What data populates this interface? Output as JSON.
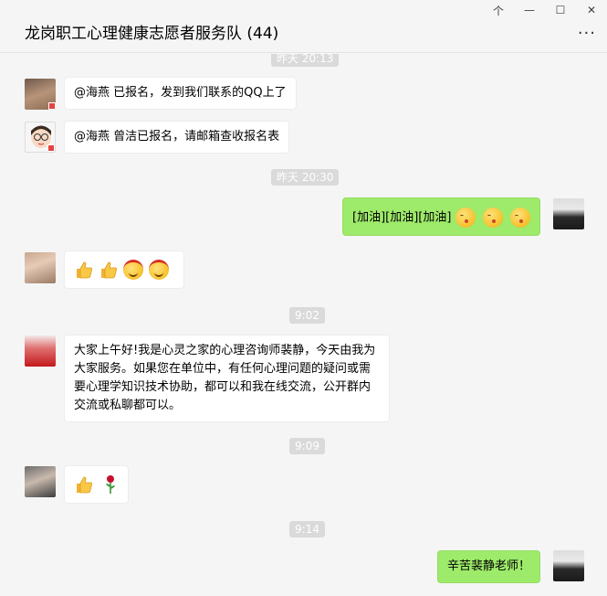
{
  "window": {
    "title": "龙岗职工心理健康志愿者服务队 (44)",
    "controls": [
      "个",
      "—",
      "☐",
      "✕"
    ],
    "more": "···"
  },
  "timestamps": [
    "昨天 20:13",
    "昨天 20:30",
    "9:02",
    "9:09",
    "9:14"
  ],
  "messages": [
    {
      "sender": "other",
      "text": "@海燕 已报名，发到我们联系的QQ上了"
    },
    {
      "sender": "other",
      "text": "@海燕 曾洁已报名，请邮箱查收报名表"
    },
    {
      "sender": "me",
      "text": "[加油][加油][加油]",
      "emoji": [
        "kiss-emoji",
        "kiss-emoji",
        "kiss-emoji"
      ]
    },
    {
      "sender": "other",
      "emoji": [
        "thumbs-up-emoji",
        "thumbs-up-emoji",
        "devil-emoji",
        "devil-emoji"
      ]
    },
    {
      "sender": "other",
      "text": "大家上午好!我是心灵之家的心理咨询师裴静，今天由我为大家服务。如果您在单位中，有任何心理问题的疑问或需要心理学知识技术协助，都可以和我在线交流，公开群内交流或私聊都可以。"
    },
    {
      "sender": "other",
      "emoji": [
        "thumbs-up-emoji",
        "rose-emoji"
      ]
    },
    {
      "sender": "me",
      "text": "辛苦裴静老师！"
    }
  ],
  "colors": {
    "background": "#f5f5f5",
    "my_bubble": "#9eea6a",
    "other_bubble": "#ffffff",
    "timestamp_bg": "#dadada"
  }
}
